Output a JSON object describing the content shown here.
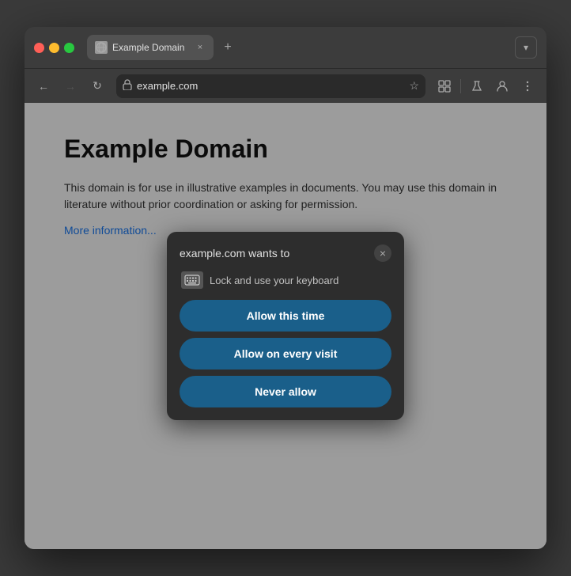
{
  "browser": {
    "tab": {
      "favicon_label": "🌐",
      "title": "Example Domain",
      "close_label": "×"
    },
    "new_tab_label": "+",
    "chevron_label": "▾",
    "nav": {
      "back_label": "←",
      "forward_label": "→",
      "reload_label": "↻",
      "url": "example.com",
      "star_label": "☆",
      "extensions_label": "⬛",
      "flask_label": "⚗",
      "profile_label": "👤",
      "menu_label": "⋮"
    }
  },
  "page": {
    "heading": "Example Domain",
    "body1": "This domain is for use in illustrative examples in documents. You may use this domain in literature without prior coordination or asking for permission.",
    "link": "More information..."
  },
  "dialog": {
    "title": "example.com wants to",
    "close_label": "×",
    "icon_label": "⌨",
    "permission_text": "Lock and use your keyboard",
    "btn_allow_once": "Allow this time",
    "btn_allow_always": "Allow on every visit",
    "btn_never": "Never allow"
  }
}
